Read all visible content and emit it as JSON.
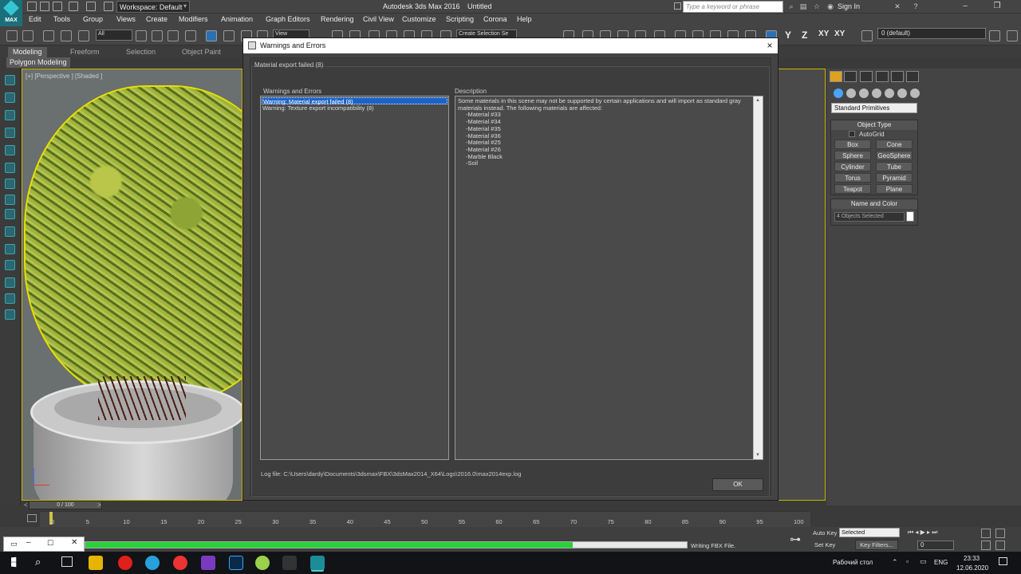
{
  "app": {
    "title": "Autodesk 3ds Max 2016",
    "document": "Untitled",
    "logo_text": "MAX",
    "workspace": "Workspace: Default",
    "search_placeholder": "Type a keyword or phrase",
    "sign_in": "Sign In"
  },
  "menu": [
    "Edit",
    "Tools",
    "Group",
    "Views",
    "Create",
    "Modifiers",
    "Animation",
    "Graph Editors",
    "Rendering",
    "Civil View",
    "Customize",
    "Scripting",
    "Corona",
    "Help"
  ],
  "toolbar": {
    "selection_filter": "All",
    "ref_coord": "View",
    "named_selection": "Create Selection Se",
    "axis_letters": [
      "Y",
      "Z",
      "XY",
      "XY"
    ],
    "layer": "0 (default)"
  },
  "ribbon": {
    "tabs": [
      "Modeling",
      "Freeform",
      "Selection",
      "Object Paint"
    ],
    "subtab": "Polygon Modeling"
  },
  "viewport": {
    "label": "[+] [Perspective ] [Shaded ]"
  },
  "command_panel": {
    "category": "Standard Primitives",
    "object_type_title": "Object Type",
    "autogrid": "AutoGrid",
    "buttons": [
      "Box",
      "Cone",
      "Sphere",
      "GeoSphere",
      "Cylinder",
      "Tube",
      "Torus",
      "Pyramid",
      "Teapot",
      "Plane"
    ],
    "name_color_title": "Name and Color",
    "name_value": "4 Objects Selected",
    "name_color_hex": "#ffffff"
  },
  "dialog": {
    "title": "Warnings and Errors",
    "close": "×",
    "summary": "Material export failed (8)",
    "warnings_header": "Warnings and Errors",
    "description_header": "Description",
    "warnings": [
      "Warning: Material export failed (8)",
      "Warning: Texture export incompatibility (8)"
    ],
    "selected_warning_index": 0,
    "description_intro": "Some materials in this scene may not be supported by certain applications and will import as standard gray materials instead. The following materials are affected:",
    "materials": [
      "-Material #33",
      "-Material #34",
      "-Material #35",
      "-Material #36",
      "-Material #25",
      "-Material #26",
      "-Marble Black",
      "-Soil"
    ],
    "log_file": "Log file: C:\\Users\\dardy\\Documents\\3dsmax\\FBX\\3dsMax2014_X64\\Logs\\2016.0\\max2014exp.log",
    "ok": "OK"
  },
  "timeline": {
    "slider": "0 / 100",
    "ticks": [
      "0",
      "5",
      "10",
      "15",
      "20",
      "25",
      "30",
      "35",
      "40",
      "45",
      "50",
      "55",
      "60",
      "65",
      "70",
      "75",
      "80",
      "85",
      "90",
      "95",
      "100"
    ]
  },
  "status": {
    "progress_fraction": 0.81,
    "progress_text": "Writing FBX File.",
    "auto_key": "Auto Key",
    "set_key": "Set Key",
    "selected": "Selected",
    "key_filters": "Key Filters...",
    "frame": "0"
  },
  "taskbar": {
    "desktop": "Рабочий стол",
    "language": "ENG",
    "time": "23:33",
    "date": "12.06.2020"
  }
}
